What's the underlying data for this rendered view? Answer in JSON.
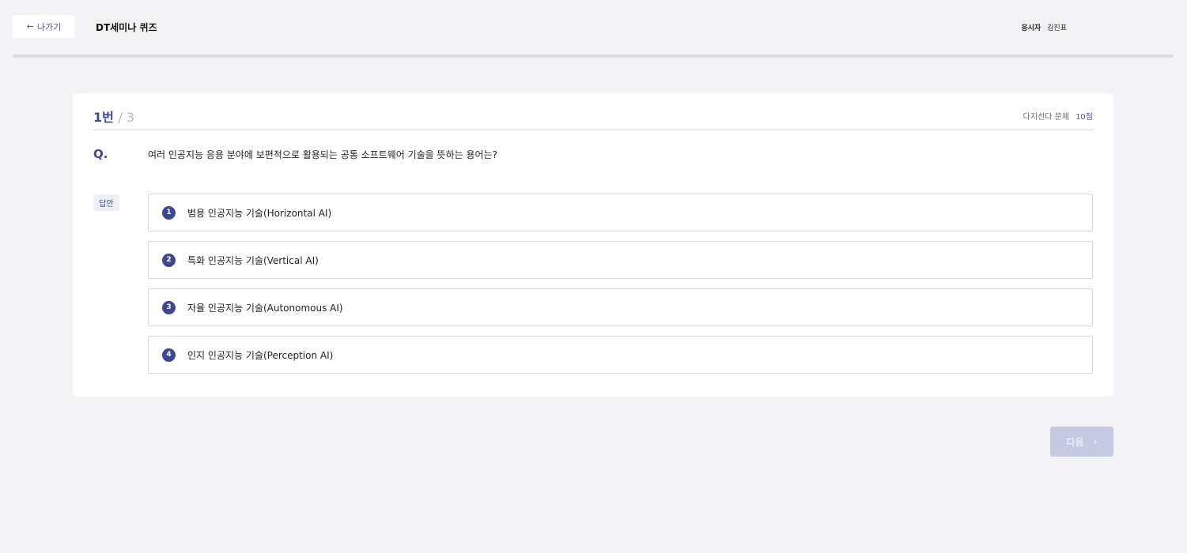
{
  "header": {
    "back_label": "나가기",
    "title": "DT세미나 퀴즈",
    "examinee_label": "응시자",
    "examinee_name": "김진표"
  },
  "progress": {
    "current": 1,
    "total": 3
  },
  "question": {
    "number_label": "1번",
    "total_label": "/ 3",
    "type_label": "다지선다 문제",
    "points_label": "10점",
    "q_marker": "Q.",
    "text": "여러 인공지능 응용 분야에 보편적으로 활용되는 공통 소프트웨어 기술을 뜻하는 용어는?"
  },
  "answer_label": "답안",
  "options": [
    {
      "num": "1",
      "text": "범용 인공지능 기술(Horizontal AI)"
    },
    {
      "num": "2",
      "text": "특화 인공지능 기술(Vertical AI)"
    },
    {
      "num": "3",
      "text": "자율 인공지능 기술(Autonomous AI)"
    },
    {
      "num": "4",
      "text": "인지 인공지능 기술(Perception AI)"
    }
  ],
  "next_label": "다음",
  "colors": {
    "accent": "#3d4796",
    "points": "#4a57c8",
    "next_disabled": "#c6c9e4",
    "background": "#f3f3f5"
  },
  "icons": {
    "back": "arrow-left-icon",
    "next": "chevron-right-icon"
  }
}
